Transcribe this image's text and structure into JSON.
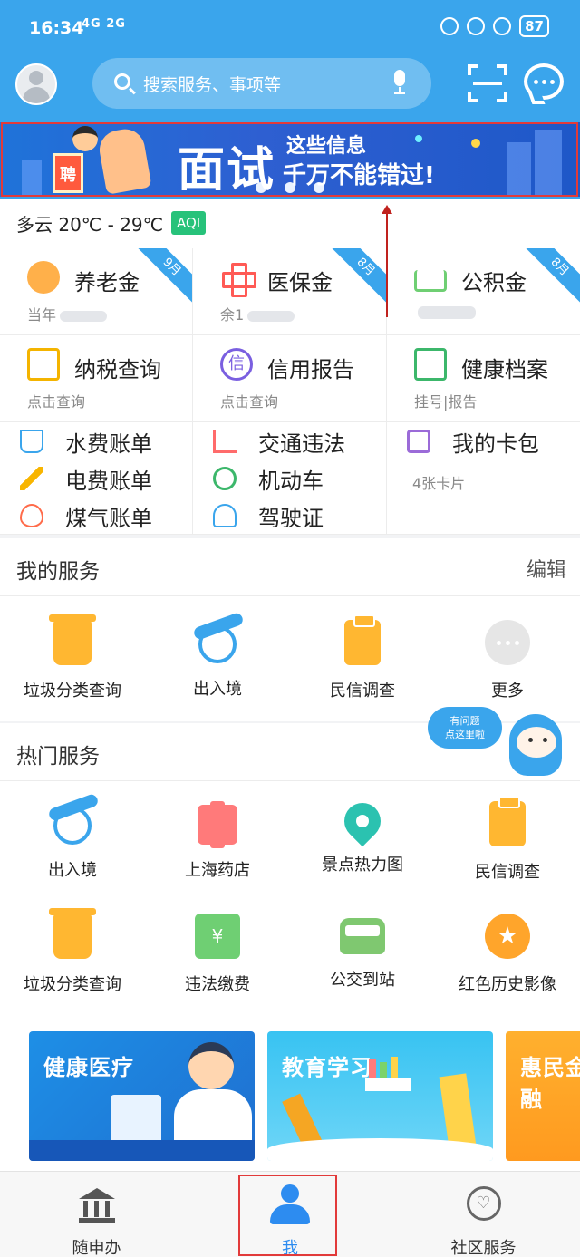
{
  "status_bar": {
    "time": "16:34",
    "signal_text": "4G 2G",
    "battery": "87"
  },
  "header": {
    "search_placeholder": "搜索服务、事项等"
  },
  "banner": {
    "title": "面试",
    "subtitle_line1": "这些信息",
    "subtitle_line2": "千万不能错过!",
    "sign_text": "聘"
  },
  "weather": {
    "text": "多云 20℃ - 29℃",
    "aqi_label": "AQI",
    "aqi_color": "#27c27a"
  },
  "quick_grid": {
    "row1": [
      {
        "title": "养老金",
        "sub": "当年",
        "ribbon": "9月",
        "icon": "elderly-icon"
      },
      {
        "title": "医保金",
        "sub": "余1",
        "ribbon": "8月",
        "icon": "medical-cross-icon"
      },
      {
        "title": "公积金",
        "sub": "",
        "ribbon": "8月",
        "icon": "house-fund-icon"
      }
    ],
    "row2": [
      {
        "title": "纳税查询",
        "sub": "点击查询",
        "icon": "tax-search-icon"
      },
      {
        "title": "信用报告",
        "sub": "点击查询",
        "icon": "credit-report-icon",
        "glyph": "信"
      },
      {
        "title": "健康档案",
        "sub": "挂号|报告",
        "icon": "health-record-icon"
      }
    ],
    "bills_col1": [
      "水费账单",
      "电费账单",
      "煤气账单"
    ],
    "bills_col2": [
      "交通违法",
      "机动车",
      "驾驶证"
    ],
    "cards": {
      "title": "我的卡包",
      "sub": "4张卡片"
    }
  },
  "my_services": {
    "title": "我的服务",
    "edit_label": "编辑",
    "items": [
      "垃圾分类查询",
      "出入境",
      "民信调查",
      "更多"
    ]
  },
  "hot_services": {
    "title": "热门服务",
    "row1": [
      "出入境",
      "上海药店",
      "景点热力图",
      "民信调查"
    ],
    "row2": [
      "垃圾分类查询",
      "违法缴费",
      "公交到站",
      "红色历史影像"
    ],
    "fine_glyph": "¥",
    "star_glyph": "★"
  },
  "chat_bot": {
    "line1": "有问题",
    "line2": "点这里啦"
  },
  "promos": [
    "健康医疗",
    "教育学习",
    "惠民金融"
  ],
  "bottom_nav": {
    "items": [
      "随申办",
      "我",
      "社区服务"
    ],
    "active_index": 1,
    "active_color": "#2d8cf0"
  },
  "colors": {
    "header_blue": "#3aa5ec",
    "highlight_red": "#e23a3a"
  }
}
